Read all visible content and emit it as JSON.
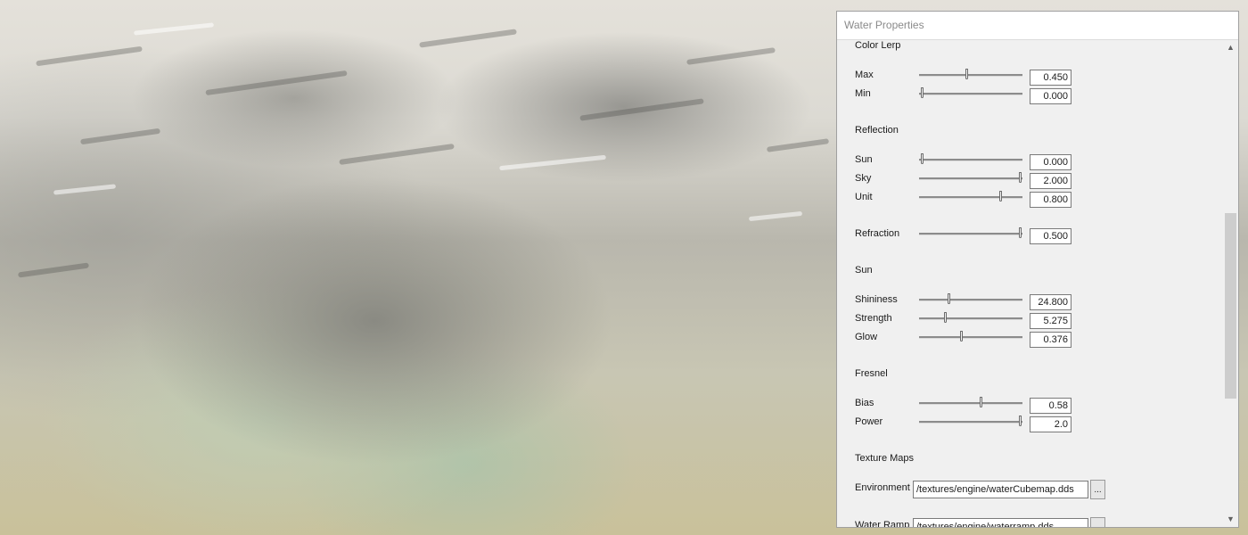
{
  "panel": {
    "title": "Water Properties",
    "sections": {
      "color_lerp": {
        "label": "Color Lerp",
        "max": {
          "label": "Max",
          "value": "0.450",
          "level": 0.45
        },
        "min": {
          "label": "Min",
          "value": "0.000",
          "level": 0.0
        }
      },
      "reflection": {
        "label": "Reflection",
        "sun": {
          "label": "Sun",
          "value": "0.000",
          "level": 0.0
        },
        "sky": {
          "label": "Sky",
          "value": "2.000",
          "level": 1.0
        },
        "unit": {
          "label": "Unit",
          "value": "0.800",
          "level": 0.8
        }
      },
      "refraction": {
        "label": "Refraction",
        "value": "0.500",
        "level": 1.0
      },
      "sun": {
        "label": "Sun",
        "shininess": {
          "label": "Shininess",
          "value": "24.800",
          "level": 0.27
        },
        "strength": {
          "label": "Strength",
          "value": "5.275",
          "level": 0.24
        },
        "glow": {
          "label": "Glow",
          "value": "0.376",
          "level": 0.4
        }
      },
      "fresnel": {
        "label": "Fresnel",
        "bias": {
          "label": "Bias",
          "value": "0.58",
          "level": 0.6
        },
        "power": {
          "label": "Power",
          "value": "2.0",
          "level": 1.0
        }
      },
      "texture_maps": {
        "label": "Texture Maps",
        "environment": {
          "label": "Environment",
          "path": "/textures/engine/waterCubemap.dds",
          "browse": "..."
        },
        "water_ramp": {
          "label": "Water Ramp",
          "path": "/textures/engine/waterramp.dds",
          "browse": "..."
        }
      }
    },
    "scrollbar": {
      "up": "▲",
      "down": "▼",
      "position": 0.45
    }
  }
}
